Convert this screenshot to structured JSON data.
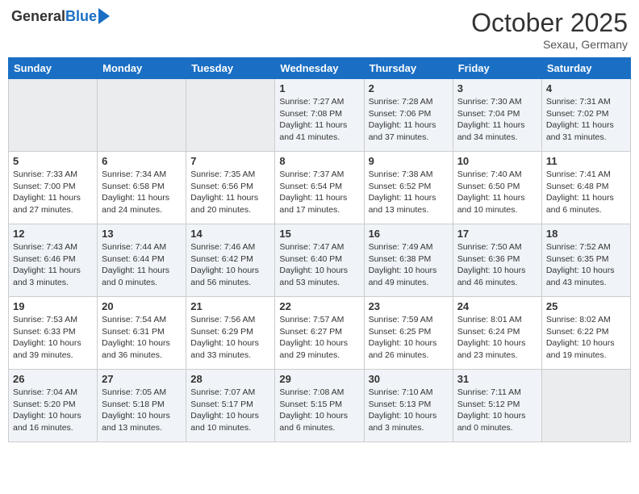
{
  "header": {
    "logo_general": "General",
    "logo_blue": "Blue",
    "month": "October 2025",
    "location": "Sexau, Germany"
  },
  "days_of_week": [
    "Sunday",
    "Monday",
    "Tuesday",
    "Wednesday",
    "Thursday",
    "Friday",
    "Saturday"
  ],
  "weeks": [
    [
      {
        "day": "",
        "empty": true
      },
      {
        "day": "",
        "empty": true
      },
      {
        "day": "",
        "empty": true
      },
      {
        "day": "1",
        "sunrise": "Sunrise: 7:27 AM",
        "sunset": "Sunset: 7:08 PM",
        "daylight": "Daylight: 11 hours and 41 minutes."
      },
      {
        "day": "2",
        "sunrise": "Sunrise: 7:28 AM",
        "sunset": "Sunset: 7:06 PM",
        "daylight": "Daylight: 11 hours and 37 minutes."
      },
      {
        "day": "3",
        "sunrise": "Sunrise: 7:30 AM",
        "sunset": "Sunset: 7:04 PM",
        "daylight": "Daylight: 11 hours and 34 minutes."
      },
      {
        "day": "4",
        "sunrise": "Sunrise: 7:31 AM",
        "sunset": "Sunset: 7:02 PM",
        "daylight": "Daylight: 11 hours and 31 minutes."
      }
    ],
    [
      {
        "day": "5",
        "sunrise": "Sunrise: 7:33 AM",
        "sunset": "Sunset: 7:00 PM",
        "daylight": "Daylight: 11 hours and 27 minutes."
      },
      {
        "day": "6",
        "sunrise": "Sunrise: 7:34 AM",
        "sunset": "Sunset: 6:58 PM",
        "daylight": "Daylight: 11 hours and 24 minutes."
      },
      {
        "day": "7",
        "sunrise": "Sunrise: 7:35 AM",
        "sunset": "Sunset: 6:56 PM",
        "daylight": "Daylight: 11 hours and 20 minutes."
      },
      {
        "day": "8",
        "sunrise": "Sunrise: 7:37 AM",
        "sunset": "Sunset: 6:54 PM",
        "daylight": "Daylight: 11 hours and 17 minutes."
      },
      {
        "day": "9",
        "sunrise": "Sunrise: 7:38 AM",
        "sunset": "Sunset: 6:52 PM",
        "daylight": "Daylight: 11 hours and 13 minutes."
      },
      {
        "day": "10",
        "sunrise": "Sunrise: 7:40 AM",
        "sunset": "Sunset: 6:50 PM",
        "daylight": "Daylight: 11 hours and 10 minutes."
      },
      {
        "day": "11",
        "sunrise": "Sunrise: 7:41 AM",
        "sunset": "Sunset: 6:48 PM",
        "daylight": "Daylight: 11 hours and 6 minutes."
      }
    ],
    [
      {
        "day": "12",
        "sunrise": "Sunrise: 7:43 AM",
        "sunset": "Sunset: 6:46 PM",
        "daylight": "Daylight: 11 hours and 3 minutes."
      },
      {
        "day": "13",
        "sunrise": "Sunrise: 7:44 AM",
        "sunset": "Sunset: 6:44 PM",
        "daylight": "Daylight: 11 hours and 0 minutes."
      },
      {
        "day": "14",
        "sunrise": "Sunrise: 7:46 AM",
        "sunset": "Sunset: 6:42 PM",
        "daylight": "Daylight: 10 hours and 56 minutes."
      },
      {
        "day": "15",
        "sunrise": "Sunrise: 7:47 AM",
        "sunset": "Sunset: 6:40 PM",
        "daylight": "Daylight: 10 hours and 53 minutes."
      },
      {
        "day": "16",
        "sunrise": "Sunrise: 7:49 AM",
        "sunset": "Sunset: 6:38 PM",
        "daylight": "Daylight: 10 hours and 49 minutes."
      },
      {
        "day": "17",
        "sunrise": "Sunrise: 7:50 AM",
        "sunset": "Sunset: 6:36 PM",
        "daylight": "Daylight: 10 hours and 46 minutes."
      },
      {
        "day": "18",
        "sunrise": "Sunrise: 7:52 AM",
        "sunset": "Sunset: 6:35 PM",
        "daylight": "Daylight: 10 hours and 43 minutes."
      }
    ],
    [
      {
        "day": "19",
        "sunrise": "Sunrise: 7:53 AM",
        "sunset": "Sunset: 6:33 PM",
        "daylight": "Daylight: 10 hours and 39 minutes."
      },
      {
        "day": "20",
        "sunrise": "Sunrise: 7:54 AM",
        "sunset": "Sunset: 6:31 PM",
        "daylight": "Daylight: 10 hours and 36 minutes."
      },
      {
        "day": "21",
        "sunrise": "Sunrise: 7:56 AM",
        "sunset": "Sunset: 6:29 PM",
        "daylight": "Daylight: 10 hours and 33 minutes."
      },
      {
        "day": "22",
        "sunrise": "Sunrise: 7:57 AM",
        "sunset": "Sunset: 6:27 PM",
        "daylight": "Daylight: 10 hours and 29 minutes."
      },
      {
        "day": "23",
        "sunrise": "Sunrise: 7:59 AM",
        "sunset": "Sunset: 6:25 PM",
        "daylight": "Daylight: 10 hours and 26 minutes."
      },
      {
        "day": "24",
        "sunrise": "Sunrise: 8:01 AM",
        "sunset": "Sunset: 6:24 PM",
        "daylight": "Daylight: 10 hours and 23 minutes."
      },
      {
        "day": "25",
        "sunrise": "Sunrise: 8:02 AM",
        "sunset": "Sunset: 6:22 PM",
        "daylight": "Daylight: 10 hours and 19 minutes."
      }
    ],
    [
      {
        "day": "26",
        "sunrise": "Sunrise: 7:04 AM",
        "sunset": "Sunset: 5:20 PM",
        "daylight": "Daylight: 10 hours and 16 minutes."
      },
      {
        "day": "27",
        "sunrise": "Sunrise: 7:05 AM",
        "sunset": "Sunset: 5:18 PM",
        "daylight": "Daylight: 10 hours and 13 minutes."
      },
      {
        "day": "28",
        "sunrise": "Sunrise: 7:07 AM",
        "sunset": "Sunset: 5:17 PM",
        "daylight": "Daylight: 10 hours and 10 minutes."
      },
      {
        "day": "29",
        "sunrise": "Sunrise: 7:08 AM",
        "sunset": "Sunset: 5:15 PM",
        "daylight": "Daylight: 10 hours and 6 minutes."
      },
      {
        "day": "30",
        "sunrise": "Sunrise: 7:10 AM",
        "sunset": "Sunset: 5:13 PM",
        "daylight": "Daylight: 10 hours and 3 minutes."
      },
      {
        "day": "31",
        "sunrise": "Sunrise: 7:11 AM",
        "sunset": "Sunset: 5:12 PM",
        "daylight": "Daylight: 10 hours and 0 minutes."
      },
      {
        "day": "",
        "empty": true
      }
    ]
  ]
}
